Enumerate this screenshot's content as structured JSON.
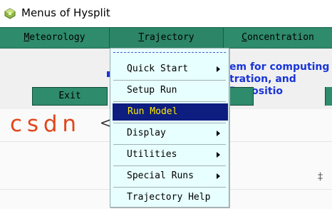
{
  "window": {
    "title": "Menus of Hysplit"
  },
  "menubar": {
    "items": [
      {
        "label_pre": "",
        "label_ul": "M",
        "label_post": "eteorology"
      },
      {
        "label_pre": "",
        "label_ul": "T",
        "label_post": "rajectory"
      },
      {
        "label_pre": "",
        "label_ul": "C",
        "label_post": "oncentration"
      }
    ]
  },
  "panel": {
    "blue_line1": "em for computing",
    "blue_line2": "tration, and Depositio",
    "exit_label": "Exit"
  },
  "background": {
    "logo_text": "CSDN",
    "arrow_glyph": "<",
    "mark": "‡"
  },
  "dropdown": {
    "items": [
      {
        "label": "Quick Start",
        "submenu": true
      },
      {
        "label": "Setup Run",
        "submenu": false
      },
      {
        "label": "Run Model",
        "submenu": false,
        "highlighted": true
      },
      {
        "label": "Display",
        "submenu": true
      },
      {
        "label": "Utilities",
        "submenu": true
      },
      {
        "label": "Special Runs",
        "submenu": true
      },
      {
        "label": "Trajectory Help",
        "submenu": false
      }
    ]
  },
  "colors": {
    "menubar": "#2e8b6b",
    "highlight_bg": "#0d1d80",
    "highlight_fg": "#ffea00",
    "dropdown_bg": "#e8ffff",
    "blue_text": "#1a35d8",
    "logo": "#e2461a"
  }
}
